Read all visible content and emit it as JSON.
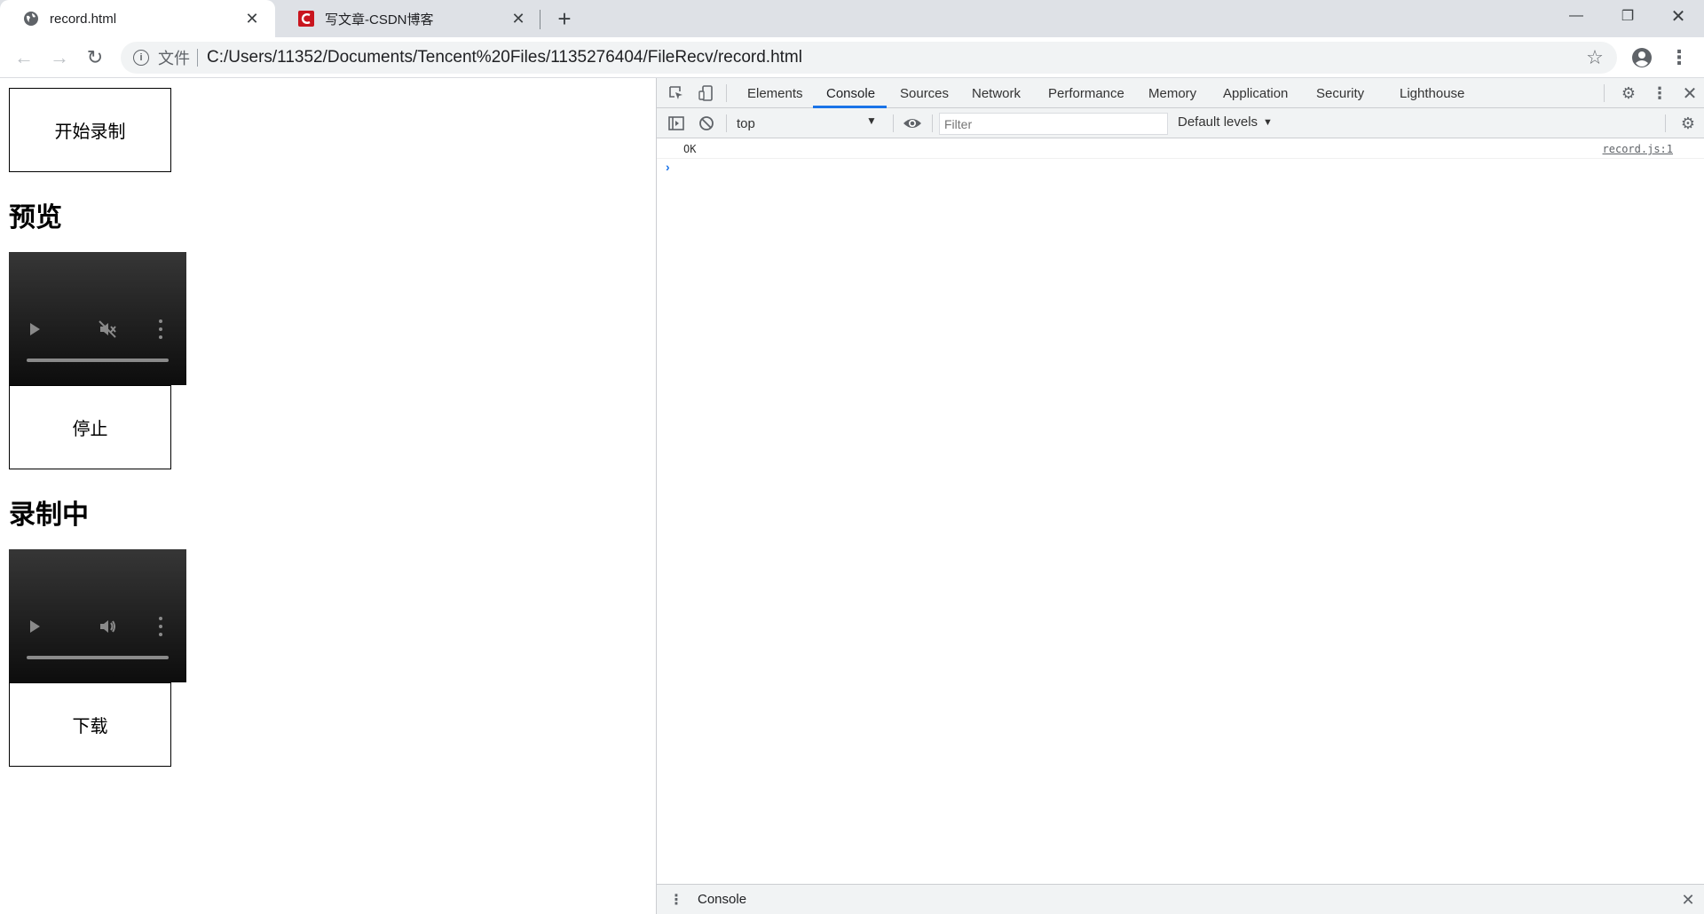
{
  "browser": {
    "tabs": [
      {
        "title": "record.html",
        "favicon": "globe-icon",
        "active": true
      },
      {
        "title": "写文章-CSDN博客",
        "favicon": "csdn-logo-icon",
        "active": false
      }
    ],
    "new_tab_label": "+",
    "window_controls": {
      "minimize": "—",
      "maximize": "❐",
      "close": "✕"
    },
    "nav": {
      "back": "←",
      "forward": "→",
      "reload": "↻"
    },
    "address": {
      "scheme_label": "文件",
      "url": "C:/Users/11352/Documents/Tencent%20Files/1135276404/FileRecv/record.html",
      "info_glyph": "i"
    },
    "star_glyph": "☆",
    "menu_glyph": "⋮"
  },
  "page": {
    "start_button": "开始录制",
    "preview_heading": "预览",
    "stop_button": "停止",
    "recording_heading": "录制中",
    "download_button": "下载",
    "preview_video": {
      "muted": true
    },
    "recording_video": {
      "muted": false
    }
  },
  "devtools": {
    "tabs": [
      "Elements",
      "Console",
      "Sources",
      "Network",
      "Performance",
      "Memory",
      "Application",
      "Security",
      "Lighthouse"
    ],
    "active_tab": "Console",
    "accent_color": "#1a73e8",
    "console_toolbar": {
      "context": "top",
      "filter_placeholder": "Filter",
      "levels": "Default levels"
    },
    "messages": [
      {
        "text": "OK",
        "source": "record.js:1"
      }
    ],
    "prompt_glyph": "›",
    "drawer": {
      "title": "Console"
    }
  }
}
